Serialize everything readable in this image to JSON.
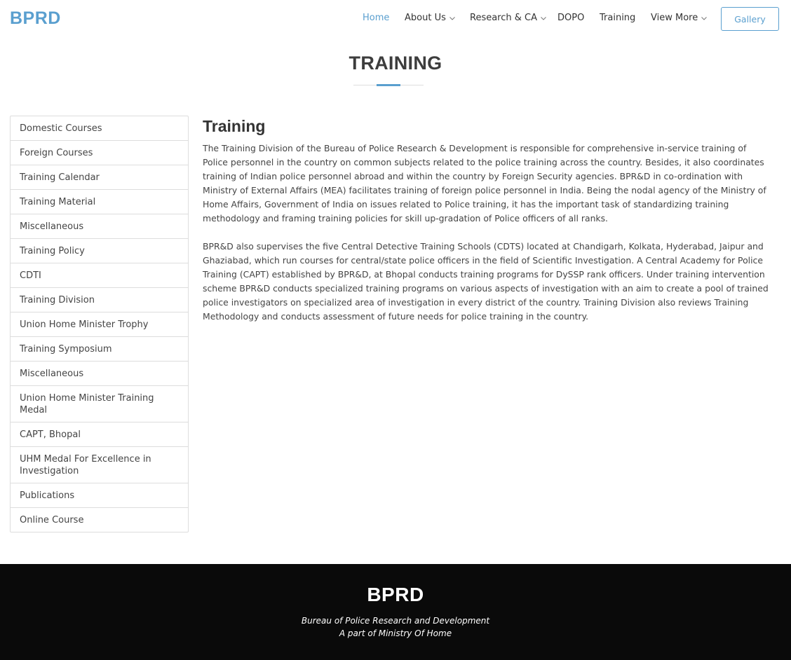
{
  "header": {
    "logo": "BPRD",
    "nav": {
      "home": "Home",
      "about": "About Us",
      "research": "Research & CA",
      "dopo": "DOPO",
      "training": "Training",
      "view_more": "View More"
    },
    "gallery_label": "Gallery"
  },
  "page": {
    "title": "TRAINING"
  },
  "sidebar": {
    "items": [
      {
        "label": "Domestic Courses"
      },
      {
        "label": "Foreign Courses"
      },
      {
        "label": "Training Calendar"
      },
      {
        "label": "Training Material"
      },
      {
        "label": "Miscellaneous"
      },
      {
        "label": "Training Policy"
      },
      {
        "label": "CDTI"
      },
      {
        "label": "Training Division"
      },
      {
        "label": "Union Home Minister Trophy"
      },
      {
        "label": "Training Symposium"
      },
      {
        "label": "Miscellaneous"
      },
      {
        "label": "Union Home Minister Training Medal"
      },
      {
        "label": "CAPT, Bhopal"
      },
      {
        "label": "UHM Medal For Excellence in Investigation"
      },
      {
        "label": "Publications"
      },
      {
        "label": "Online Course"
      }
    ]
  },
  "content": {
    "heading": "Training",
    "paragraphs": [
      "The Training Division of the Bureau of Police Research & Development is responsible for comprehensive in-service training of Police personnel in the country on common subjects related to the police training across the country. Besides, it also coordinates training of Indian police personnel abroad and within the country by Foreign Security agencies. BPR&D in co-ordination with Ministry of External Affairs (MEA) facilitates training of foreign police personnel in India. Being the nodal agency of the Ministry of Home Affairs, Government of India on issues related to Police training, it has the important task of standardizing training methodology and framing training policies for skill up-gradation of Police officers of all ranks.",
      "BPR&D also supervises the five Central Detective Training Schools (CDTS) located at Chandigarh, Kolkata, Hyderabad, Jaipur and Ghaziabad, which run courses for central/state police officers in the field of Scientific Investigation. A Central Academy for Police Training (CAPT) established by BPR&D, at Bhopal conducts training programs for DySSP rank officers. Under training intervention scheme BPR&D conducts specialized training programs on various aspects of investigation with an aim to create a pool of trained police investigators on specialized area of investigation in every district of the country. Training Division also reviews Training Methodology and conducts assessment of future needs for police training in the country."
    ]
  },
  "footer": {
    "logo": "BPRD",
    "line1": "Bureau of Police Research and Development",
    "line2": "A part of Ministry Of Home"
  },
  "colors": {
    "accent": "#5a9fcf",
    "footer_bg": "#0a0a0a",
    "text": "#444444"
  },
  "icons": {
    "dropdown": "chevron-down-icon"
  }
}
